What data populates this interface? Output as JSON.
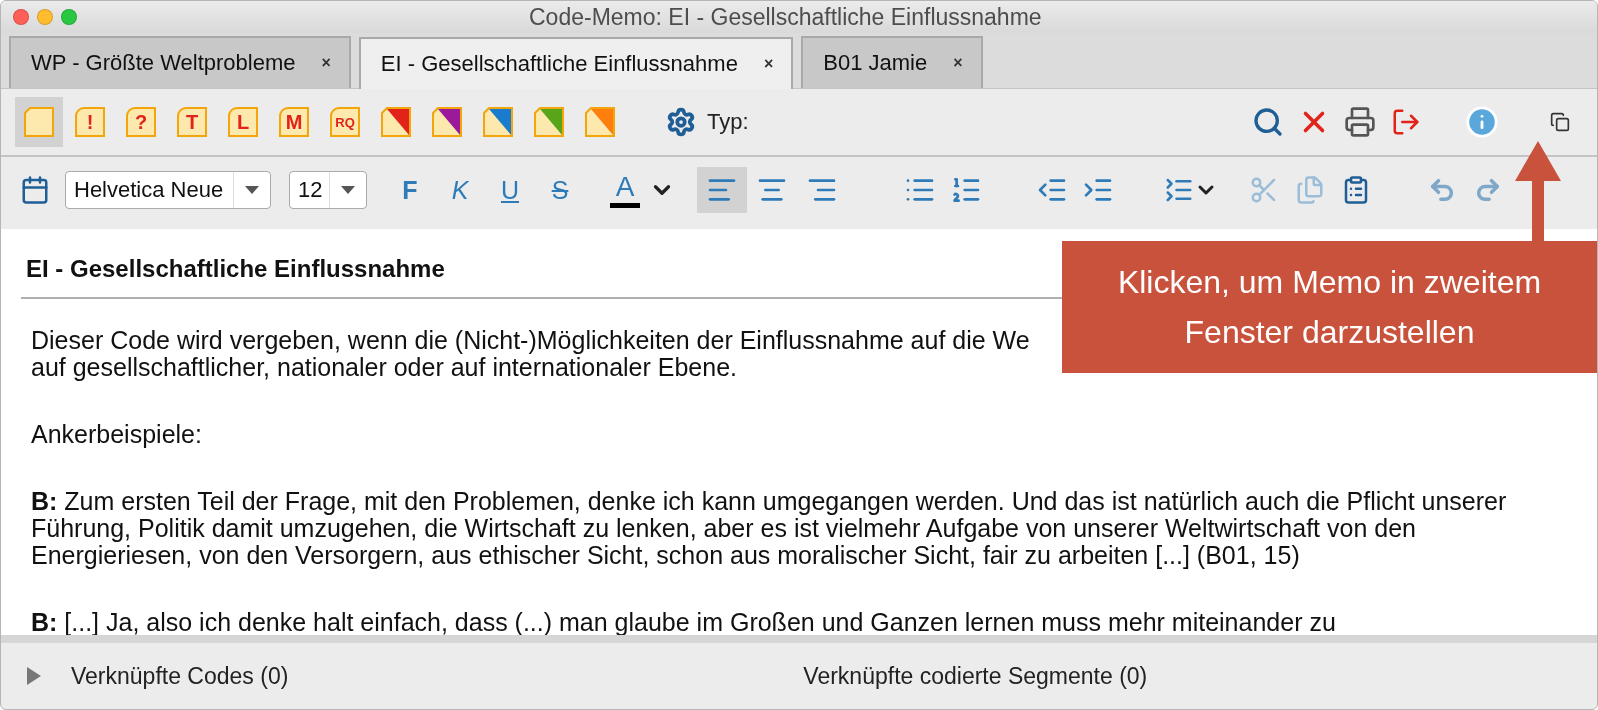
{
  "window": {
    "title": "Code-Memo: EI - Gesellschaftliche Einflussnahme"
  },
  "tabs": [
    {
      "label": "WP - Größte Weltprobleme",
      "close": "×",
      "selected": false
    },
    {
      "label": "EI - Gesellschaftliche Einflussnahme",
      "close": "×",
      "selected": true
    },
    {
      "label": "B01 Jamie",
      "close": "×",
      "selected": false
    }
  ],
  "memo_types": [
    {
      "kind": "plain",
      "selected": true
    },
    {
      "kind": "letter",
      "label": "!",
      "selected": false
    },
    {
      "kind": "letter",
      "label": "?",
      "selected": false
    },
    {
      "kind": "letter",
      "label": "T",
      "selected": false
    },
    {
      "kind": "letter",
      "label": "L",
      "selected": false
    },
    {
      "kind": "letter",
      "label": "M",
      "selected": false
    },
    {
      "kind": "letter",
      "label": "RQ",
      "selected": false
    },
    {
      "kind": "color",
      "color": "#e2231a",
      "selected": false
    },
    {
      "kind": "color",
      "color": "#9b1a9a",
      "selected": false
    },
    {
      "kind": "color",
      "color": "#1a7ccc",
      "selected": false
    },
    {
      "kind": "color",
      "color": "#58a51a",
      "selected": false
    },
    {
      "kind": "color",
      "color": "#ff7f0e",
      "selected": false
    }
  ],
  "type_label": "Typ:",
  "format_toolbar": {
    "font": "Helvetica Neue",
    "size": "12",
    "styles": [
      {
        "kind": "bold",
        "label": "F"
      },
      {
        "kind": "italic",
        "label": "K"
      },
      {
        "kind": "underline",
        "label": "U"
      },
      {
        "kind": "strike",
        "label": "S"
      }
    ],
    "text_color": {
      "label": "A"
    },
    "alignment": [
      {
        "kind": "left",
        "selected": true
      },
      {
        "kind": "center",
        "selected": false
      },
      {
        "kind": "right",
        "selected": false
      }
    ]
  },
  "memo": {
    "title": "EI - Gesellschaftliche Einflussnahme",
    "paragraphs": [
      {
        "lines": [
          "Dieser Code wird vergeben, wenn die (Nicht-)Möglichkeiten der Einflussnahme auf die We",
          "auf gesellschaftlicher, nationaler oder auf internationaler Ebene."
        ]
      },
      {
        "lines": [
          "Ankerbeispiele:"
        ]
      },
      {
        "lines": [
          "**B:** Zum ersten Teil der Frage, mit den Problemen, denke ich kann umgegangen werden. Und das ist natürlich auch die Pflicht unserer Führung, Politik damit umzugehen, die Wirtschaft zu lenken, aber es ist vielmehr Aufgabe von unserer Weltwirtschaft von den Energieriesen, von den Versorgern, aus ethischer Sicht, schon aus moralischer Sicht, fair zu arbeiten [...] (B01, 15)"
        ]
      },
      {
        "lines": [
          "**B:** [...] Ja, also ich denke halt einfach, dass (...) man glaube im Großen und Ganzen lernen muss mehr miteinander zu"
        ]
      }
    ]
  },
  "callout": {
    "text": "Klicken, um Memo in zweitem Fenster darzustellen"
  },
  "footer": {
    "expanded": false,
    "linked_codes": "Verknüpfte Codes (0)",
    "linked_segments": "Verknüpfte codierte Segmente (0)"
  }
}
